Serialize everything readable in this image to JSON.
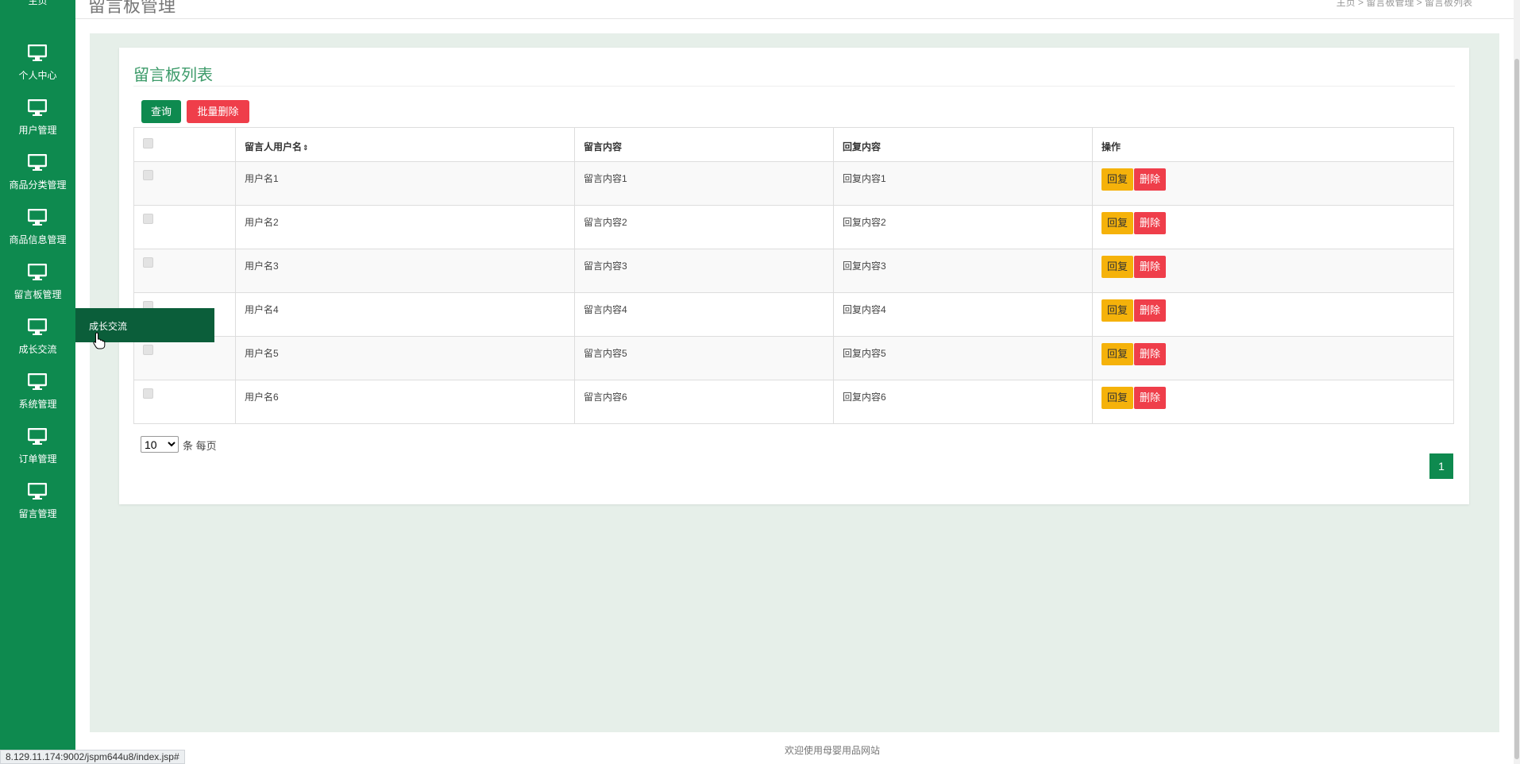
{
  "header": {
    "page_title": "留言板管理",
    "breadcrumb": "主页 > 留言板管理 > 留言板列表"
  },
  "sidebar": {
    "items": [
      {
        "label": "主页"
      },
      {
        "label": "个人中心"
      },
      {
        "label": "用户管理"
      },
      {
        "label": "商品分类管理"
      },
      {
        "label": "商品信息管理"
      },
      {
        "label": "留言板管理"
      },
      {
        "label": "成长交流"
      },
      {
        "label": "系统管理"
      },
      {
        "label": "订单管理"
      },
      {
        "label": "留言管理"
      }
    ],
    "flyout_label": "成长交流"
  },
  "panel": {
    "title": "留言板列表",
    "query_button": "查询",
    "batch_delete_button": "批量删除"
  },
  "table": {
    "columns": [
      "留言人用户名",
      "留言内容",
      "回复内容",
      "操作"
    ],
    "sort_glyph": "⇕",
    "rows": [
      {
        "username": "用户名1",
        "content": "留言内容1",
        "reply": "回复内容1"
      },
      {
        "username": "用户名2",
        "content": "留言内容2",
        "reply": "回复内容2"
      },
      {
        "username": "用户名3",
        "content": "留言内容3",
        "reply": "回复内容3"
      },
      {
        "username": "用户名4",
        "content": "留言内容4",
        "reply": "回复内容4"
      },
      {
        "username": "用户名5",
        "content": "留言内容5",
        "reply": "回复内容5"
      },
      {
        "username": "用户名6",
        "content": "留言内容6",
        "reply": "回复内容6"
      }
    ],
    "reply_button": "回复",
    "delete_button": "删除"
  },
  "pager": {
    "page_size": "10",
    "page_size_suffix": "条 每页",
    "current_page": "1"
  },
  "footer": {
    "text": "欢迎使用母婴用品网站"
  },
  "status_url": "8.129.11.174:9002/jspm644u8/index.jsp#",
  "colors": {
    "primary": "#0e8a4f",
    "danger": "#ef3e4a",
    "warning": "#f5b20a",
    "content_bg": "#e6efe9"
  },
  "icons": {
    "sidebar_item": "monitor-icon",
    "cursor": "hand-pointer-icon"
  }
}
